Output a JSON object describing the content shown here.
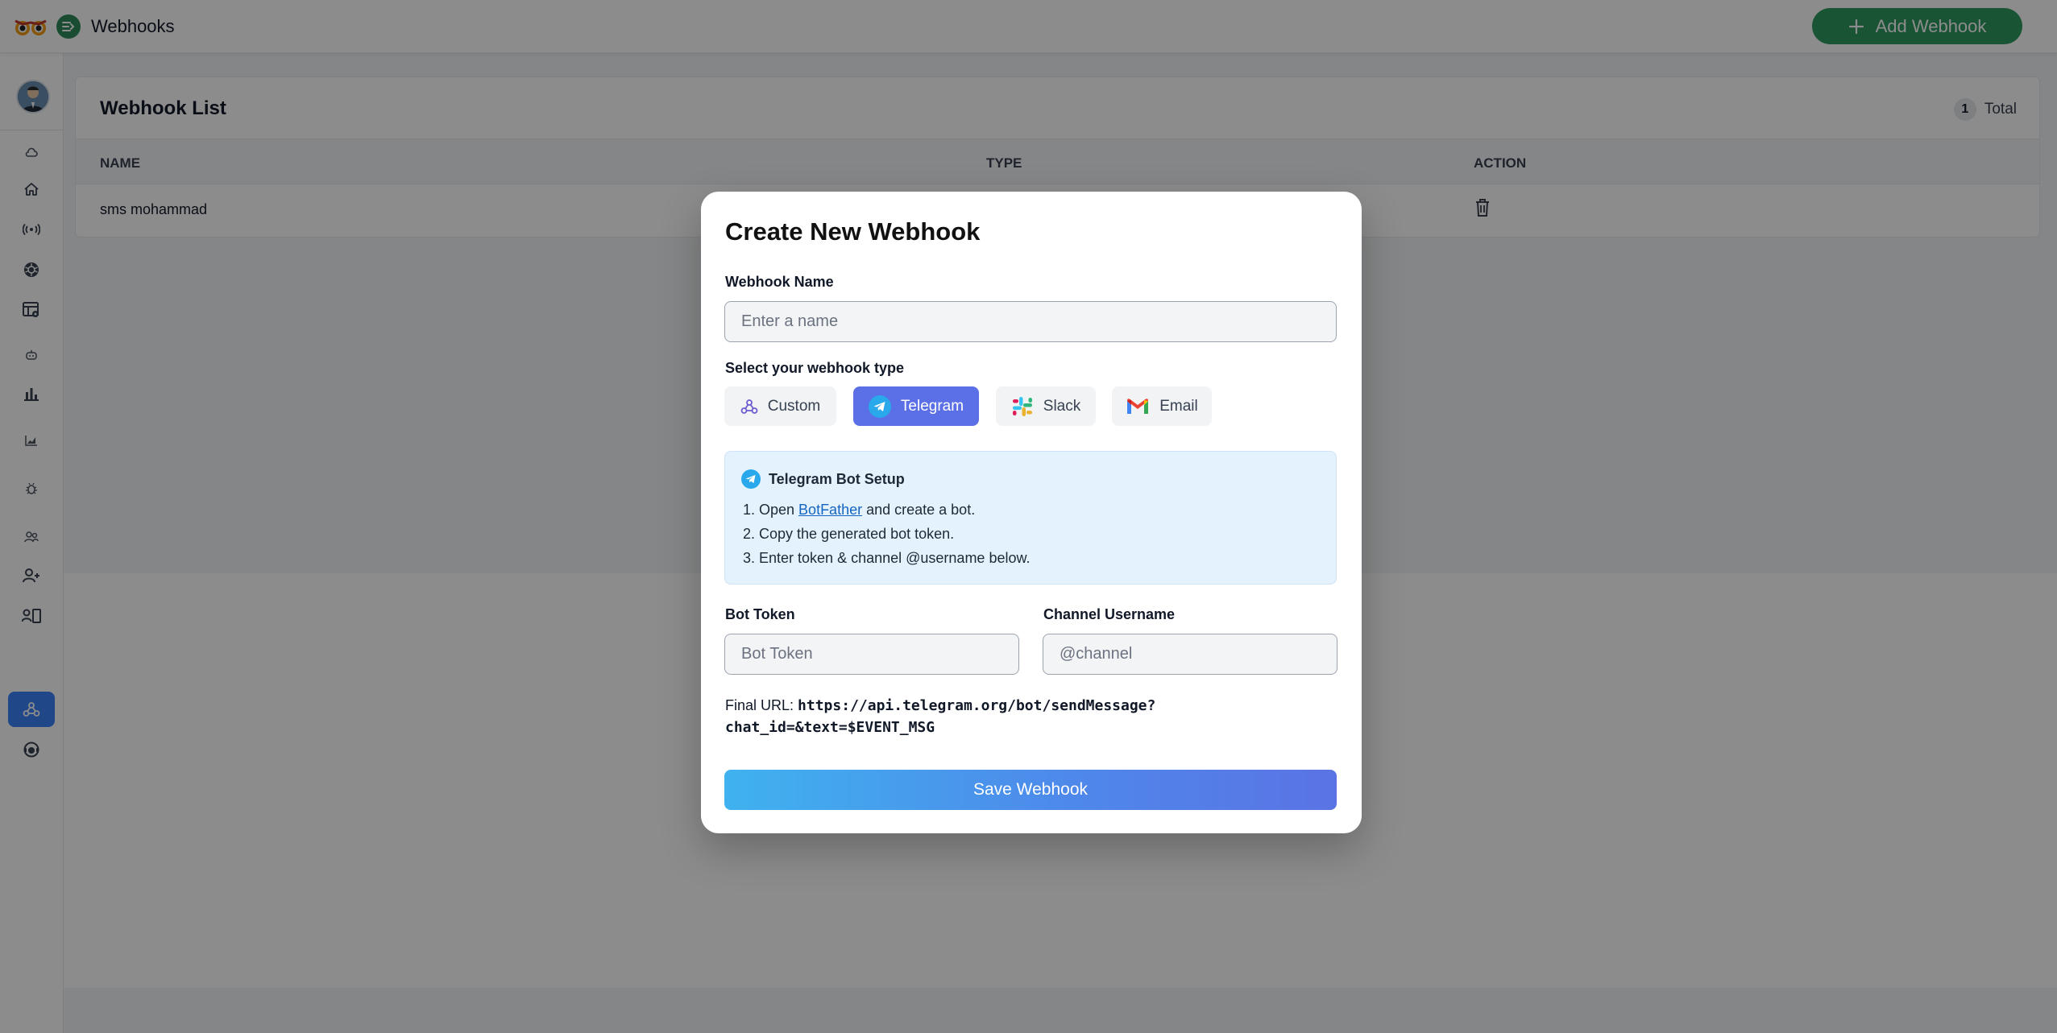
{
  "header": {
    "title": "Webhooks",
    "add_button_label": "Add Webhook"
  },
  "sidebar": {
    "items": [
      {
        "icon": "cloud-icon"
      },
      {
        "icon": "home-icon"
      },
      {
        "icon": "broadcast-icon"
      },
      {
        "icon": "kubernetes-icon"
      },
      {
        "icon": "dashboard-settings-icon"
      },
      {
        "icon": "robot-icon"
      },
      {
        "icon": "bar-chart-icon"
      },
      {
        "icon": "area-chart-icon"
      },
      {
        "icon": "bug-icon"
      },
      {
        "icon": "users-icon"
      },
      {
        "icon": "add-user-icon"
      },
      {
        "icon": "contact-card-icon"
      },
      {
        "icon": "webhook-icon",
        "active": true
      },
      {
        "icon": "support-agent-icon"
      }
    ]
  },
  "webhook_list": {
    "title": "Webhook List",
    "count": "1",
    "count_label": "Total",
    "columns": [
      "NAME",
      "TYPE",
      "ACTION"
    ],
    "rows": [
      {
        "name": "sms mohammad",
        "type": ""
      }
    ]
  },
  "modal": {
    "title": "Create New Webhook",
    "name_label": "Webhook Name",
    "name_placeholder": "Enter a name",
    "name_value": "",
    "type_label": "Select your webhook type",
    "types": [
      {
        "label": "Custom",
        "icon": "webhook-icon"
      },
      {
        "label": "Telegram",
        "icon": "telegram-icon",
        "selected": true
      },
      {
        "label": "Slack",
        "icon": "slack-icon"
      },
      {
        "label": "Email",
        "icon": "gmail-icon"
      }
    ],
    "setup": {
      "title": "Telegram Bot Setup",
      "step1_prefix": "1. Open ",
      "step1_link": "BotFather",
      "step1_suffix": " and create a bot.",
      "step2": "2. Copy the generated bot token.",
      "step3": "3. Enter token & channel @username below."
    },
    "bot_token_label": "Bot Token",
    "bot_token_placeholder": "Bot Token",
    "channel_label": "Channel Username",
    "channel_placeholder": "@channel",
    "final_url_label": "Final URL:",
    "final_url_line1": "https://api.telegram.org/bot/sendMessage?",
    "final_url_line2": "chat_id=&text=$EVENT_MSG",
    "save_label": "Save Webhook"
  },
  "colors": {
    "brand_green": "#2f9a61",
    "primary_blue": "#5b6fe6",
    "info_bg": "#e3f2fd",
    "telegram": "#29a9eb"
  }
}
